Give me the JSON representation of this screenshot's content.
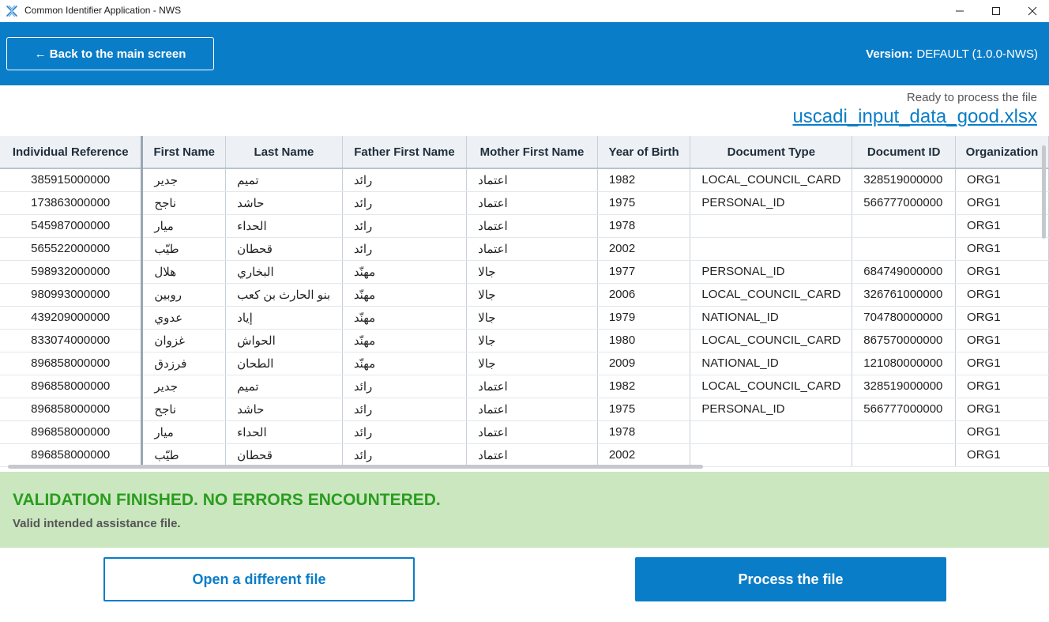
{
  "window": {
    "title": "Common Identifier Application - NWS",
    "controls": [
      "minimize-icon",
      "maximize-icon",
      "close-icon"
    ]
  },
  "header": {
    "back_label": "← Back to the main screen",
    "version_label": "Version:",
    "version_value": "DEFAULT (1.0.0-NWS)"
  },
  "file": {
    "status": "Ready to process the file",
    "name": "uscadi_input_data_good.xlsx"
  },
  "table": {
    "columns": [
      "Individual Reference",
      "First Name",
      "Last Name",
      "Father First Name",
      "Mother First Name",
      "Year of Birth",
      "Document Type",
      "Document ID",
      "Organization"
    ],
    "rows": [
      [
        "385915000000",
        "جدير",
        "تميم",
        "رائد",
        "اعتماد",
        "1982",
        "LOCAL_COUNCIL_CARD",
        "328519000000",
        "ORG1"
      ],
      [
        "173863000000",
        "ناجح",
        "حاشد",
        "رائد",
        "اعتماد",
        "1975",
        "PERSONAL_ID",
        "566777000000",
        "ORG1"
      ],
      [
        "545987000000",
        "ميار",
        "الحداء",
        "رائد",
        "اعتماد",
        "1978",
        "",
        "",
        "ORG1"
      ],
      [
        "565522000000",
        "طيّب",
        "قحطان",
        "رائد",
        "اعتماد",
        "2002",
        "",
        "",
        "ORG1"
      ],
      [
        "598932000000",
        "هلال",
        "البخاري",
        "مهنّد",
        "جالا",
        "1977",
        "PERSONAL_ID",
        "684749000000",
        "ORG1"
      ],
      [
        "980993000000",
        "روبين",
        "بنو الحارث بن كعب",
        "مهنّد",
        "جالا",
        "2006",
        "LOCAL_COUNCIL_CARD",
        "326761000000",
        "ORG1"
      ],
      [
        "439209000000",
        "عدوي",
        "إياد",
        "مهنّد",
        "جالا",
        "1979",
        "NATIONAL_ID",
        "704780000000",
        "ORG1"
      ],
      [
        "833074000000",
        "غزوان",
        "الحواش",
        "مهنّد",
        "جالا",
        "1980",
        "LOCAL_COUNCIL_CARD",
        "867570000000",
        "ORG1"
      ],
      [
        "896858000000",
        "فرزدق",
        "الطحان",
        "مهنّد",
        "جالا",
        "2009",
        "NATIONAL_ID",
        "121080000000",
        "ORG1"
      ],
      [
        "896858000000",
        "جدير",
        "تميم",
        "رائد",
        "اعتماد",
        "1982",
        "LOCAL_COUNCIL_CARD",
        "328519000000",
        "ORG1"
      ],
      [
        "896858000000",
        "ناجح",
        "حاشد",
        "رائد",
        "اعتماد",
        "1975",
        "PERSONAL_ID",
        "566777000000",
        "ORG1"
      ],
      [
        "896858000000",
        "ميار",
        "الحداء",
        "رائد",
        "اعتماد",
        "1978",
        "",
        "",
        "ORG1"
      ],
      [
        "896858000000",
        "طيّب",
        "قحطان",
        "رائد",
        "اعتماد",
        "2002",
        "",
        "",
        "ORG1"
      ]
    ]
  },
  "validation": {
    "title": "VALIDATION FINISHED. NO ERRORS ENCOUNTERED.",
    "subtitle": "Valid intended assistance file."
  },
  "actions": {
    "open_label": "Open a different file",
    "process_label": "Process the file"
  },
  "colors": {
    "accent": "#0a7dc8",
    "success_bg": "#cbe7c0",
    "success_text": "#2a9d1e"
  }
}
